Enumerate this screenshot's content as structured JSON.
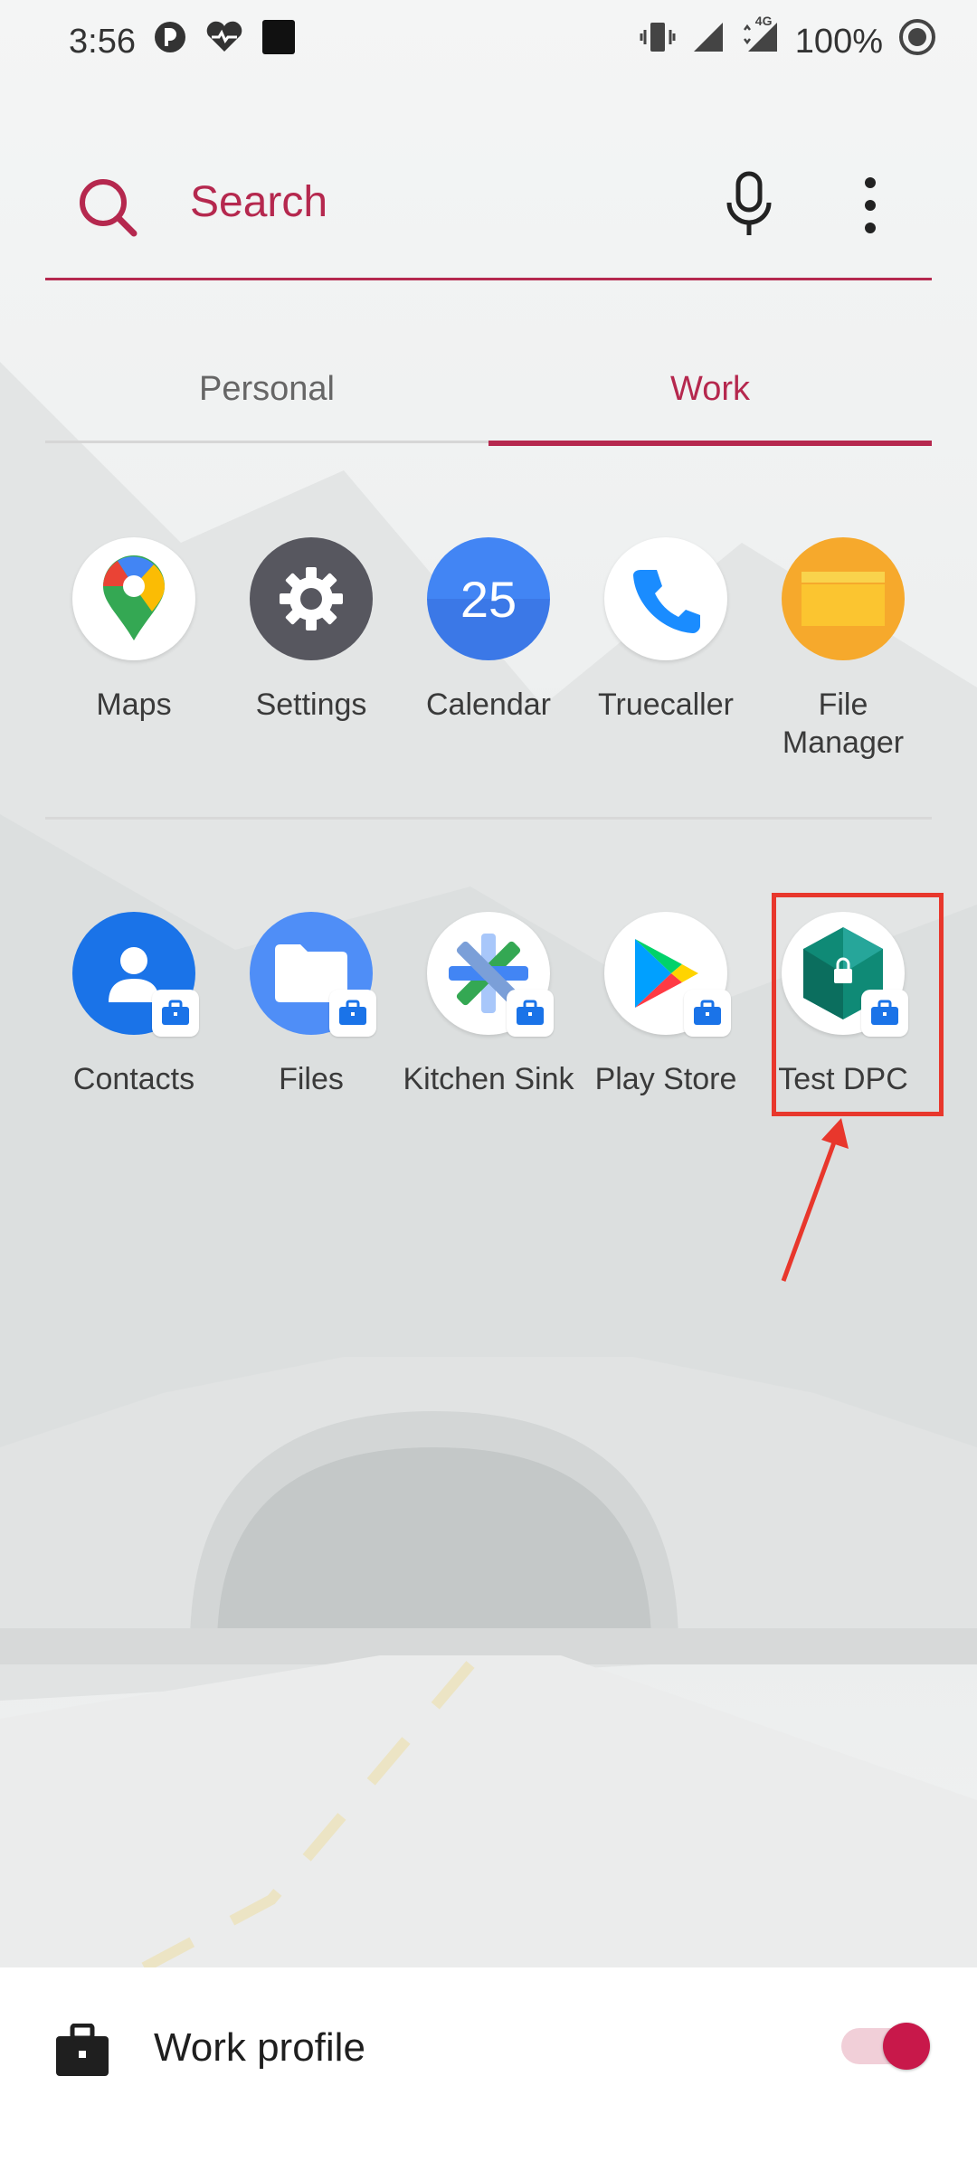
{
  "status_bar": {
    "time": "3:56",
    "network": "4G",
    "battery": "100%",
    "icons": [
      "notification-icon",
      "heart-icon",
      "square-icon",
      "vibrate-icon",
      "signal-icon",
      "signal-4g-icon",
      "battery-icon"
    ]
  },
  "search": {
    "label": "Search",
    "icons": [
      "search-icon",
      "mic-icon",
      "more-vert-icon"
    ],
    "accent_color": "#b5284e"
  },
  "tabs": [
    {
      "label": "Personal",
      "active": false
    },
    {
      "label": "Work",
      "active": true
    }
  ],
  "apps_row1": [
    {
      "label": "Maps",
      "icon": "maps-icon"
    },
    {
      "label": "Settings",
      "icon": "gear-icon"
    },
    {
      "label": "Calendar",
      "icon": "calendar-icon",
      "icon_text": "25"
    },
    {
      "label": "Truecaller",
      "icon": "phone-icon"
    },
    {
      "label": "File\nManager",
      "icon": "folder-icon"
    }
  ],
  "apps_row2": [
    {
      "label": "Contacts",
      "icon": "contacts-icon",
      "work_badge": true
    },
    {
      "label": "Files",
      "icon": "files-icon",
      "work_badge": true
    },
    {
      "label": "Kitchen Sink",
      "icon": "kitchen-sink-icon",
      "work_badge": true
    },
    {
      "label": "Play Store",
      "icon": "play-store-icon",
      "work_badge": true
    },
    {
      "label": "Test DPC",
      "icon": "test-dpc-icon",
      "work_badge": true,
      "highlighted": true
    }
  ],
  "annotation": {
    "color": "#e8372c"
  },
  "work_profile": {
    "label": "Work profile",
    "toggle_on": true,
    "toggle_color": "#c8184a"
  }
}
